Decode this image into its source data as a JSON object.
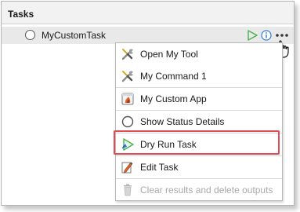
{
  "panel": {
    "title": "Tasks"
  },
  "task": {
    "name": "MyCustomTask"
  },
  "menu": {
    "items": [
      {
        "label": "Open My Tool",
        "icon": "tools-icon",
        "enabled": true
      },
      {
        "label": "My Command 1",
        "icon": "tools-icon",
        "enabled": true
      },
      {
        "label": "My Custom App",
        "icon": "app-icon",
        "enabled": true
      },
      {
        "label": "Show Status Details",
        "icon": "status-circle-icon",
        "enabled": true
      },
      {
        "label": "Dry Run Task",
        "icon": "dry-run-icon",
        "enabled": true,
        "highlighted": true
      },
      {
        "label": "Edit Task",
        "icon": "edit-icon",
        "enabled": true
      },
      {
        "label": "Clear results and delete outputs",
        "icon": "trash-icon",
        "enabled": false
      }
    ]
  },
  "colors": {
    "highlight_border": "#e24a55",
    "run_green": "#4caf50",
    "info_blue": "#2d7bd6",
    "disabled_text": "#a9a9a9"
  }
}
